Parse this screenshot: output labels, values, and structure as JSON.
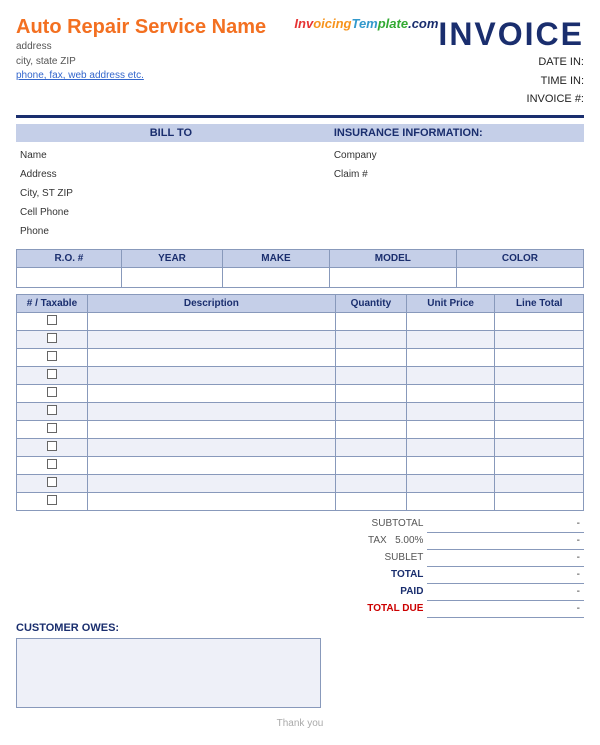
{
  "header": {
    "company_name": "Auto Repair Service Name",
    "address_line1": "address",
    "address_line2": "city, state ZIP",
    "contact_link": "phone, fax, web address etc.",
    "invoice_title": "INVOICE",
    "date_in_label": "DATE IN:",
    "time_in_label": "TIME IN:",
    "invoice_num_label": "INVOICE #:",
    "branding": "InvoicingTemplate.com"
  },
  "bill_to": {
    "header": "BILL TO",
    "fields": [
      {
        "label": "Name"
      },
      {
        "label": "Address"
      },
      {
        "label": "City, ST ZIP"
      },
      {
        "label": "Cell Phone"
      },
      {
        "label": "Phone"
      }
    ]
  },
  "insurance": {
    "header": "INSURANCE INFORMATION:",
    "fields": [
      {
        "label": "Company"
      },
      {
        "label": "Claim #"
      }
    ]
  },
  "vehicle_table": {
    "columns": [
      "R.O. #",
      "YEAR",
      "MAKE",
      "MODEL",
      "COLOR"
    ]
  },
  "items_table": {
    "columns": [
      "# / Taxable",
      "Description",
      "Quantity",
      "Unit Price",
      "Line Total"
    ],
    "row_count": 11
  },
  "totals": {
    "subtotal_label": "SUBTOTAL",
    "tax_label": "TAX",
    "tax_rate": "5.00%",
    "sublet_label": "SUBLET",
    "total_label": "TOTAL",
    "paid_label": "PAID",
    "total_due_label": "TOTAL DUE",
    "dash": "-"
  },
  "customer_owes": {
    "label": "CUSTOMER OWES:"
  },
  "footer": {
    "text": "Thank you"
  }
}
